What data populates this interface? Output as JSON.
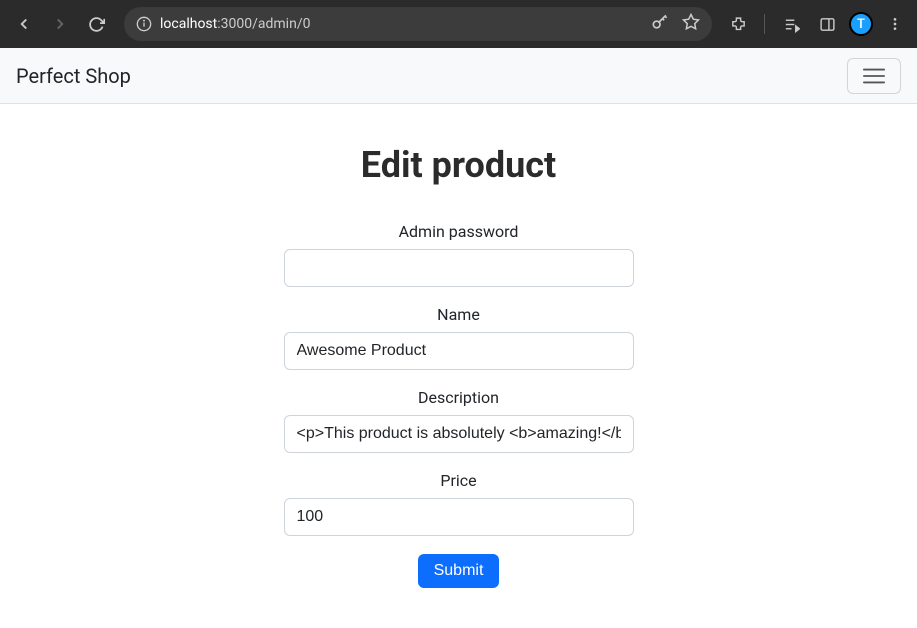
{
  "browser": {
    "url_host": "localhost",
    "url_rest": ":3000/admin/0",
    "avatar_letter": "T"
  },
  "navbar": {
    "brand": "Perfect Shop"
  },
  "page": {
    "title": "Edit product"
  },
  "form": {
    "admin_password_label": "Admin password",
    "admin_password_value": "",
    "name_label": "Name",
    "name_value": "Awesome Product",
    "description_label": "Description",
    "description_value": "<p>This product is absolutely <b>amazing!</b></p>",
    "price_label": "Price",
    "price_value": "100",
    "submit_label": "Submit"
  }
}
